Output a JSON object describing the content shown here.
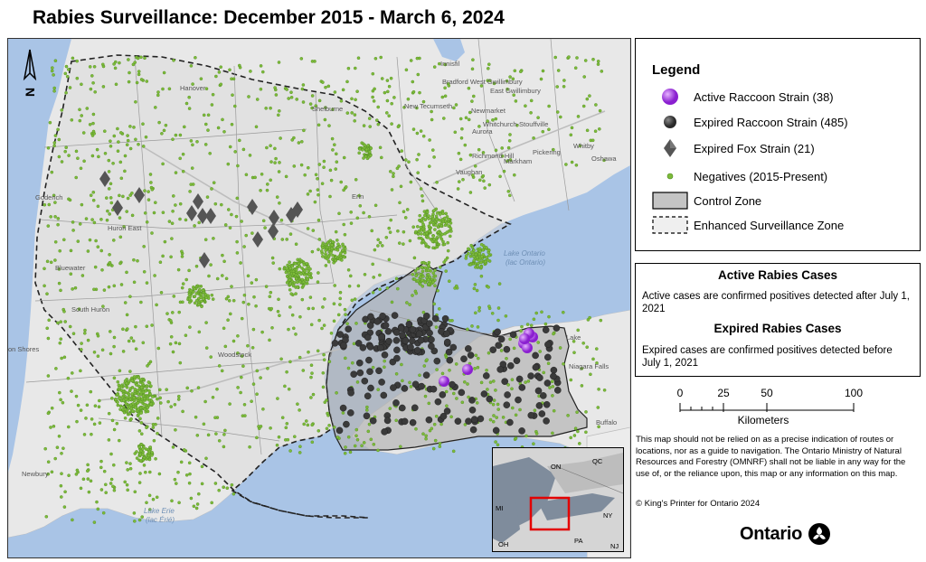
{
  "title": "Rabies Surveillance: December 2015 - March 6, 2024",
  "colors": {
    "active": "#9b30d9",
    "expired_raccoon": "#3a3a3a",
    "fox": "#555555",
    "negative": "#7dbb3a",
    "control_zone": "#b8b8b8",
    "water": "#a9c4e6",
    "land": "#e9e9e9"
  },
  "legend": {
    "title": "Legend",
    "items": [
      {
        "label": "Active Raccoon Strain (38)",
        "icon": "purple-sphere-icon"
      },
      {
        "label": "Expired Raccoon Strain (485)",
        "icon": "dark-sphere-icon"
      },
      {
        "label": "Expired Fox Strain (21)",
        "icon": "diamond-icon"
      },
      {
        "label": "Negatives (2015-Present)",
        "icon": "green-dot-icon"
      },
      {
        "label": "Control Zone",
        "icon": "gray-rect-icon"
      },
      {
        "label": "Enhanced Surveillance Zone",
        "icon": "dashed-rect-icon"
      }
    ]
  },
  "info": {
    "active_heading": "Active Rabies Cases",
    "active_text": "Active cases are confirmed positives detected after July 1, 2021",
    "expired_heading": "Expired Rabies Cases",
    "expired_text": "Expired cases are confirmed positives detected before July 1, 2021"
  },
  "scale": {
    "ticks": [
      "0",
      "25",
      "50",
      "100"
    ],
    "unit": "Kilometers"
  },
  "disclaimer": "This map should not be relied on as a precise indication of routes or locations, nor as a guide to navigation. The Ontario Ministry of Natural Resources and Forestry (OMNRF) shall not be liable in any way for the use of, or the reliance upon, this map or any information on this map.",
  "copyright": "© King's Printer for Ontario 2024",
  "logo_text": "Ontario",
  "north_arrow": "N",
  "inset": {
    "labels": [
      "ON",
      "QC",
      "MI",
      "NY",
      "PA",
      "OH",
      "NJ"
    ]
  },
  "map_labels": {
    "places": [
      "Innisfil",
      "Bradford West Gwillimbury",
      "East Gwillimbury",
      "Newmarket",
      "Whitchurch-Stouffville",
      "Aurora",
      "Richmond Hill",
      "Markham",
      "Pickering",
      "Whitby",
      "Oshawa",
      "Vaughan",
      "New Tecumseth",
      "Shelburne",
      "Hanover",
      "Goderich",
      "Huron East",
      "Bluewater",
      "South Huron",
      "Erin",
      "Lake",
      "Niagara Falls",
      "Buffalo",
      "Newbury",
      "Woodstock",
      "on Shores"
    ],
    "lakes": [
      "Lake Ontario (lac Ontario)",
      "Lake Erie (lac Érié)"
    ]
  }
}
